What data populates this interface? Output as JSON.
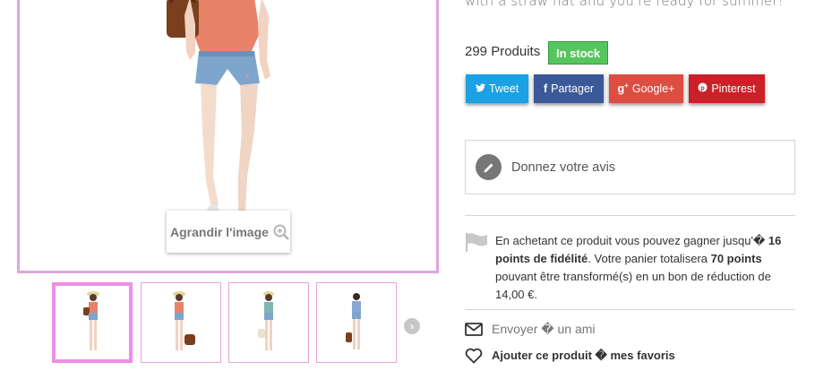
{
  "product": {
    "description_fragment": "with a straw hat and you're ready for summer!",
    "quantity": "299 Produits",
    "availability": "In stock",
    "zoom_label": "Agrandir l'image"
  },
  "thumbnails": [
    {
      "alt": "thumb-1",
      "active": true
    },
    {
      "alt": "thumb-2",
      "active": false
    },
    {
      "alt": "thumb-3",
      "active": false
    },
    {
      "alt": "thumb-4",
      "active": false
    }
  ],
  "social": {
    "tweet": "Tweet",
    "facebook": "Partager",
    "google": "Google+",
    "pinterest": "Pinterest"
  },
  "review": {
    "label": "Donnez votre avis"
  },
  "loyalty": {
    "part1": "En achetant ce produit vous pouvez gagner jusqu'� ",
    "points": "16 points de fidélité",
    "part2": ". Votre panier totalisera ",
    "total": "70 points",
    "part3": " pouvant être transformé(s) en un bon de réduction de 14,00 €."
  },
  "actions": {
    "send": "Envoyer � un ami",
    "favorite": "Ajouter ce produit � mes favoris"
  },
  "colors": {
    "image_border": "#dfa6db",
    "in_stock": "#55c65e",
    "twitter": "#1ba1e4",
    "facebook": "#3b5998",
    "google": "#dc4e41",
    "pinterest": "#cb2027"
  },
  "icons": {
    "zoom": "magnifier-plus-icon",
    "next": "chevron-right-icon",
    "review": "pencil-icon",
    "loyalty": "flag-icon",
    "send": "envelope-icon",
    "favorite": "heart-icon"
  }
}
